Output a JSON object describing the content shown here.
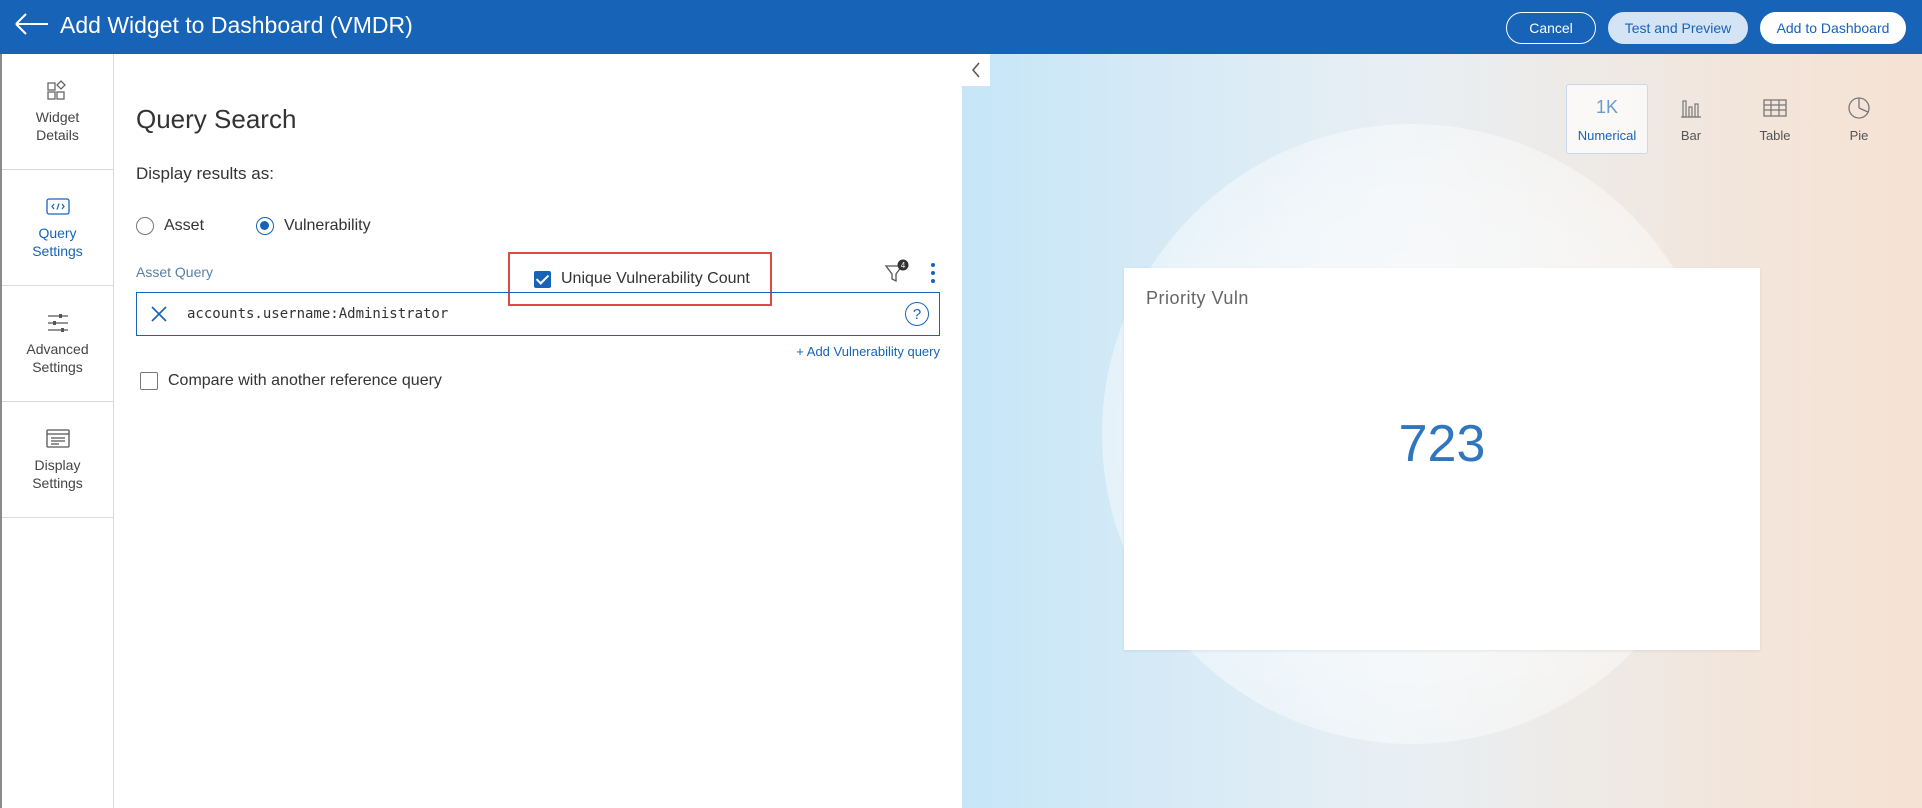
{
  "header": {
    "title": "Add Widget to Dashboard (VMDR)",
    "cancel_label": "Cancel",
    "test_label": "Test and Preview",
    "add_label": "Add to Dashboard"
  },
  "nav": {
    "items": [
      {
        "line1": "Widget",
        "line2": "Details",
        "icon": "widget-details-icon"
      },
      {
        "line1": "Query",
        "line2": "Settings",
        "icon": "code-icon",
        "active": true
      },
      {
        "line1": "Advanced",
        "line2": "Settings",
        "icon": "sliders-icon"
      },
      {
        "line1": "Display",
        "line2": "Settings",
        "icon": "display-icon"
      }
    ]
  },
  "form": {
    "title": "Query Search",
    "display_label": "Display results as:",
    "options": {
      "asset": "Asset",
      "vulnerability": "Vulnerability",
      "selected": "Vulnerability"
    },
    "unique_count_label": "Unique Vulnerability Count",
    "unique_count_checked": true,
    "asset_query_label": "Asset Query",
    "filter_badge": "4",
    "query_value": "accounts.username:Administrator",
    "help_glyph": "?",
    "add_vuln_query": "+ Add Vulnerability query",
    "compare_label": "Compare with another reference query",
    "compare_checked": false
  },
  "preview": {
    "types": [
      {
        "label": "Numerical",
        "glyph": "1K",
        "active": true
      },
      {
        "label": "Bar",
        "glyph": ""
      },
      {
        "label": "Table",
        "glyph": ""
      },
      {
        "label": "Pie",
        "glyph": ""
      }
    ],
    "card_title": "Priority Vuln",
    "card_value": "723"
  },
  "colors": {
    "brand": "#1763b7",
    "highlight": "#e04848"
  }
}
